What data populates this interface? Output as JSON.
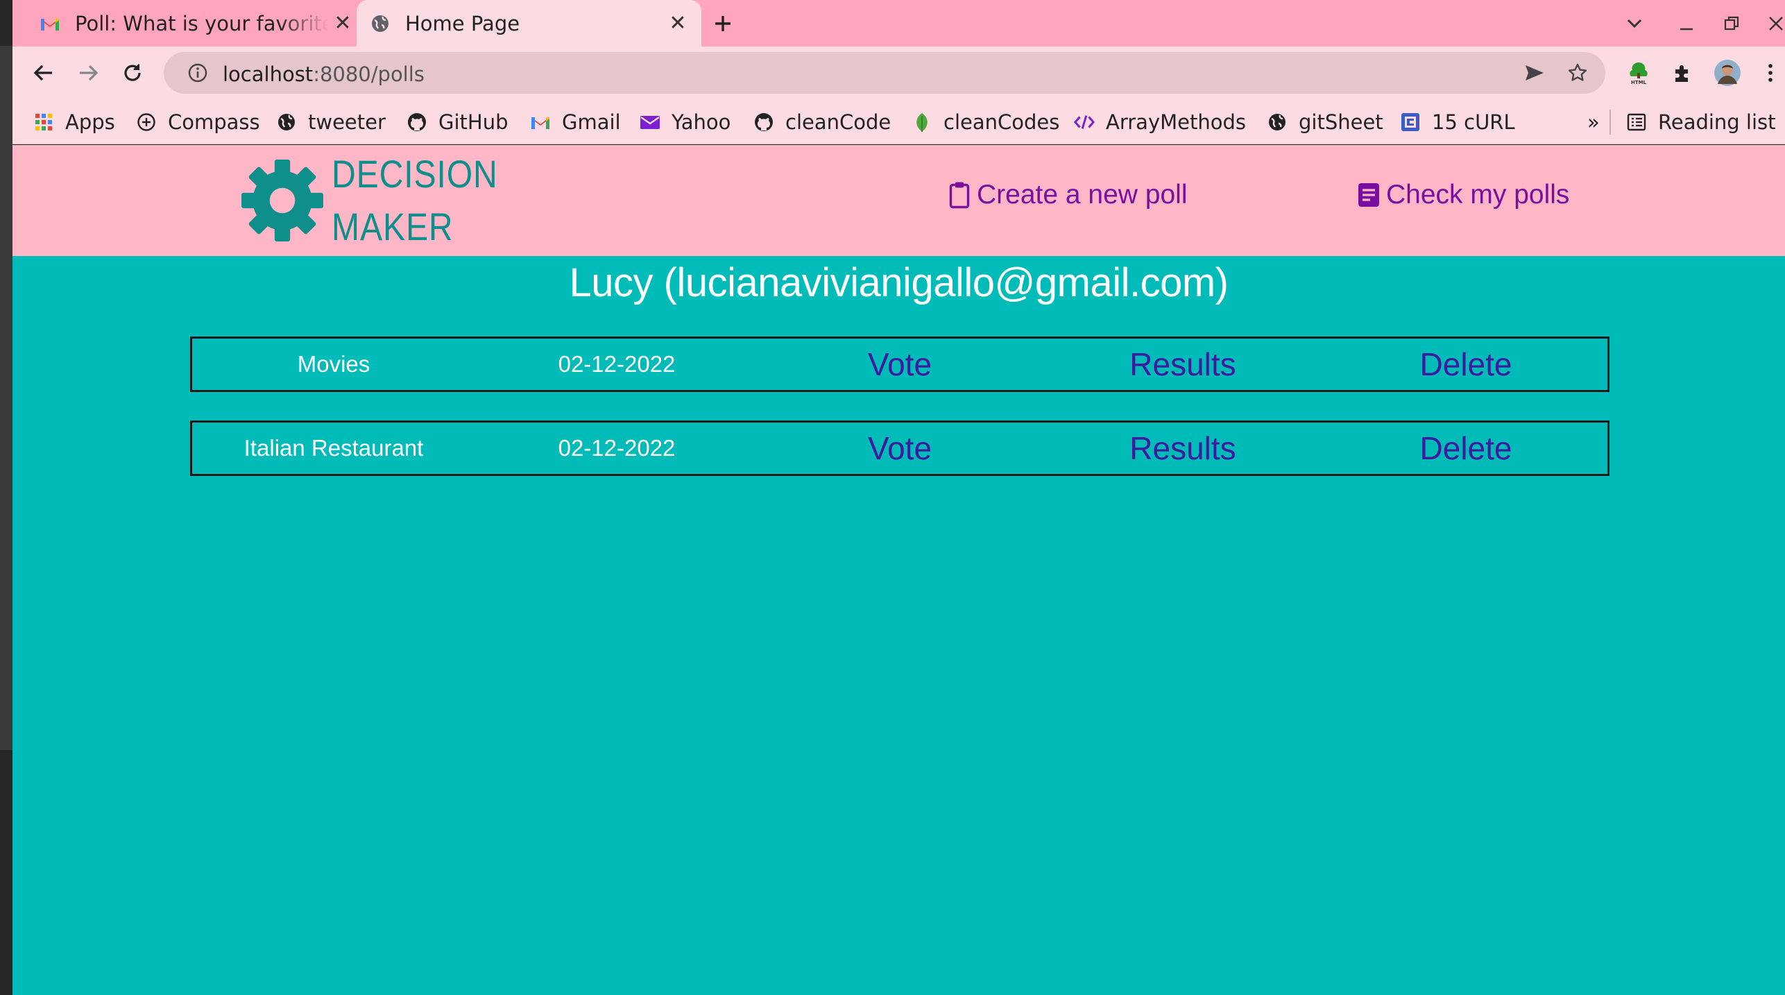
{
  "browser": {
    "tabs": [
      {
        "title": "Poll: What is your favorite",
        "icon": "gmail-icon"
      },
      {
        "title": "Home Page",
        "icon": "globe-icon"
      }
    ],
    "address_host": "localhost",
    "address_path": ":8080/polls",
    "bookmarks": [
      {
        "label": "Apps",
        "icon": "apps-grid-icon"
      },
      {
        "label": "Compass",
        "icon": "compass-icon"
      },
      {
        "label": "tweeter",
        "icon": "globe-icon"
      },
      {
        "label": "GitHub",
        "icon": "github-icon"
      },
      {
        "label": "Gmail",
        "icon": "gmail-icon"
      },
      {
        "label": "Yahoo",
        "icon": "mail-icon"
      },
      {
        "label": "cleanCode",
        "icon": "github-icon"
      },
      {
        "label": "cleanCodes",
        "icon": "leaf-icon"
      },
      {
        "label": "ArrayMethods",
        "icon": "code-icon"
      },
      {
        "label": "gitSheet",
        "icon": "globe-icon"
      },
      {
        "label": "15 cURL",
        "icon": "bookmark-box-icon"
      }
    ],
    "overflow_label": "»",
    "reading_list": "Reading list"
  },
  "site": {
    "logo_line1": "DECISION",
    "logo_line2": "MAKER",
    "nav_create": "Create a new poll",
    "nav_check": "Check my polls",
    "colors": {
      "header_bg": "#ffb6c6",
      "page_bg": "#00bbb8",
      "logo": "#0f8f8c",
      "nav": "#7a0f9f",
      "action": "#3d1a9e"
    }
  },
  "user_heading": "Lucy (lucianavivianigallo@gmail.com)",
  "polls": [
    {
      "name": "Movies",
      "date": "02-12-2022",
      "vote": "Vote",
      "results": "Results",
      "delete": "Delete"
    },
    {
      "name": "Italian Restaurant",
      "date": "02-12-2022",
      "vote": "Vote",
      "results": "Results",
      "delete": "Delete"
    }
  ]
}
